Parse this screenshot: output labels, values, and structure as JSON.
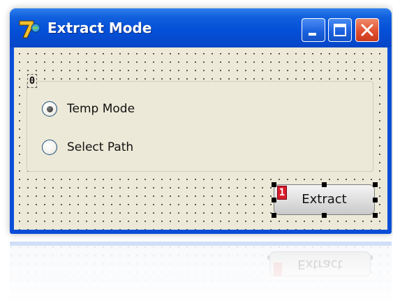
{
  "window": {
    "title": "Extract Mode",
    "icon": "7zip-app-icon",
    "controls": {
      "minimize": "minimize-icon",
      "maximize": "maximize-icon",
      "close": "close-icon"
    }
  },
  "form": {
    "group_tag": "0",
    "options": [
      {
        "label": "Temp Mode",
        "selected": true
      },
      {
        "label": "Select Path",
        "selected": false
      }
    ],
    "button_tag": "1",
    "extract_label": "Extract"
  },
  "colors": {
    "titlebar": "#0550d8",
    "client": "#ece9d8",
    "close_button": "#e05030",
    "tag_red": "#d81c2c"
  }
}
